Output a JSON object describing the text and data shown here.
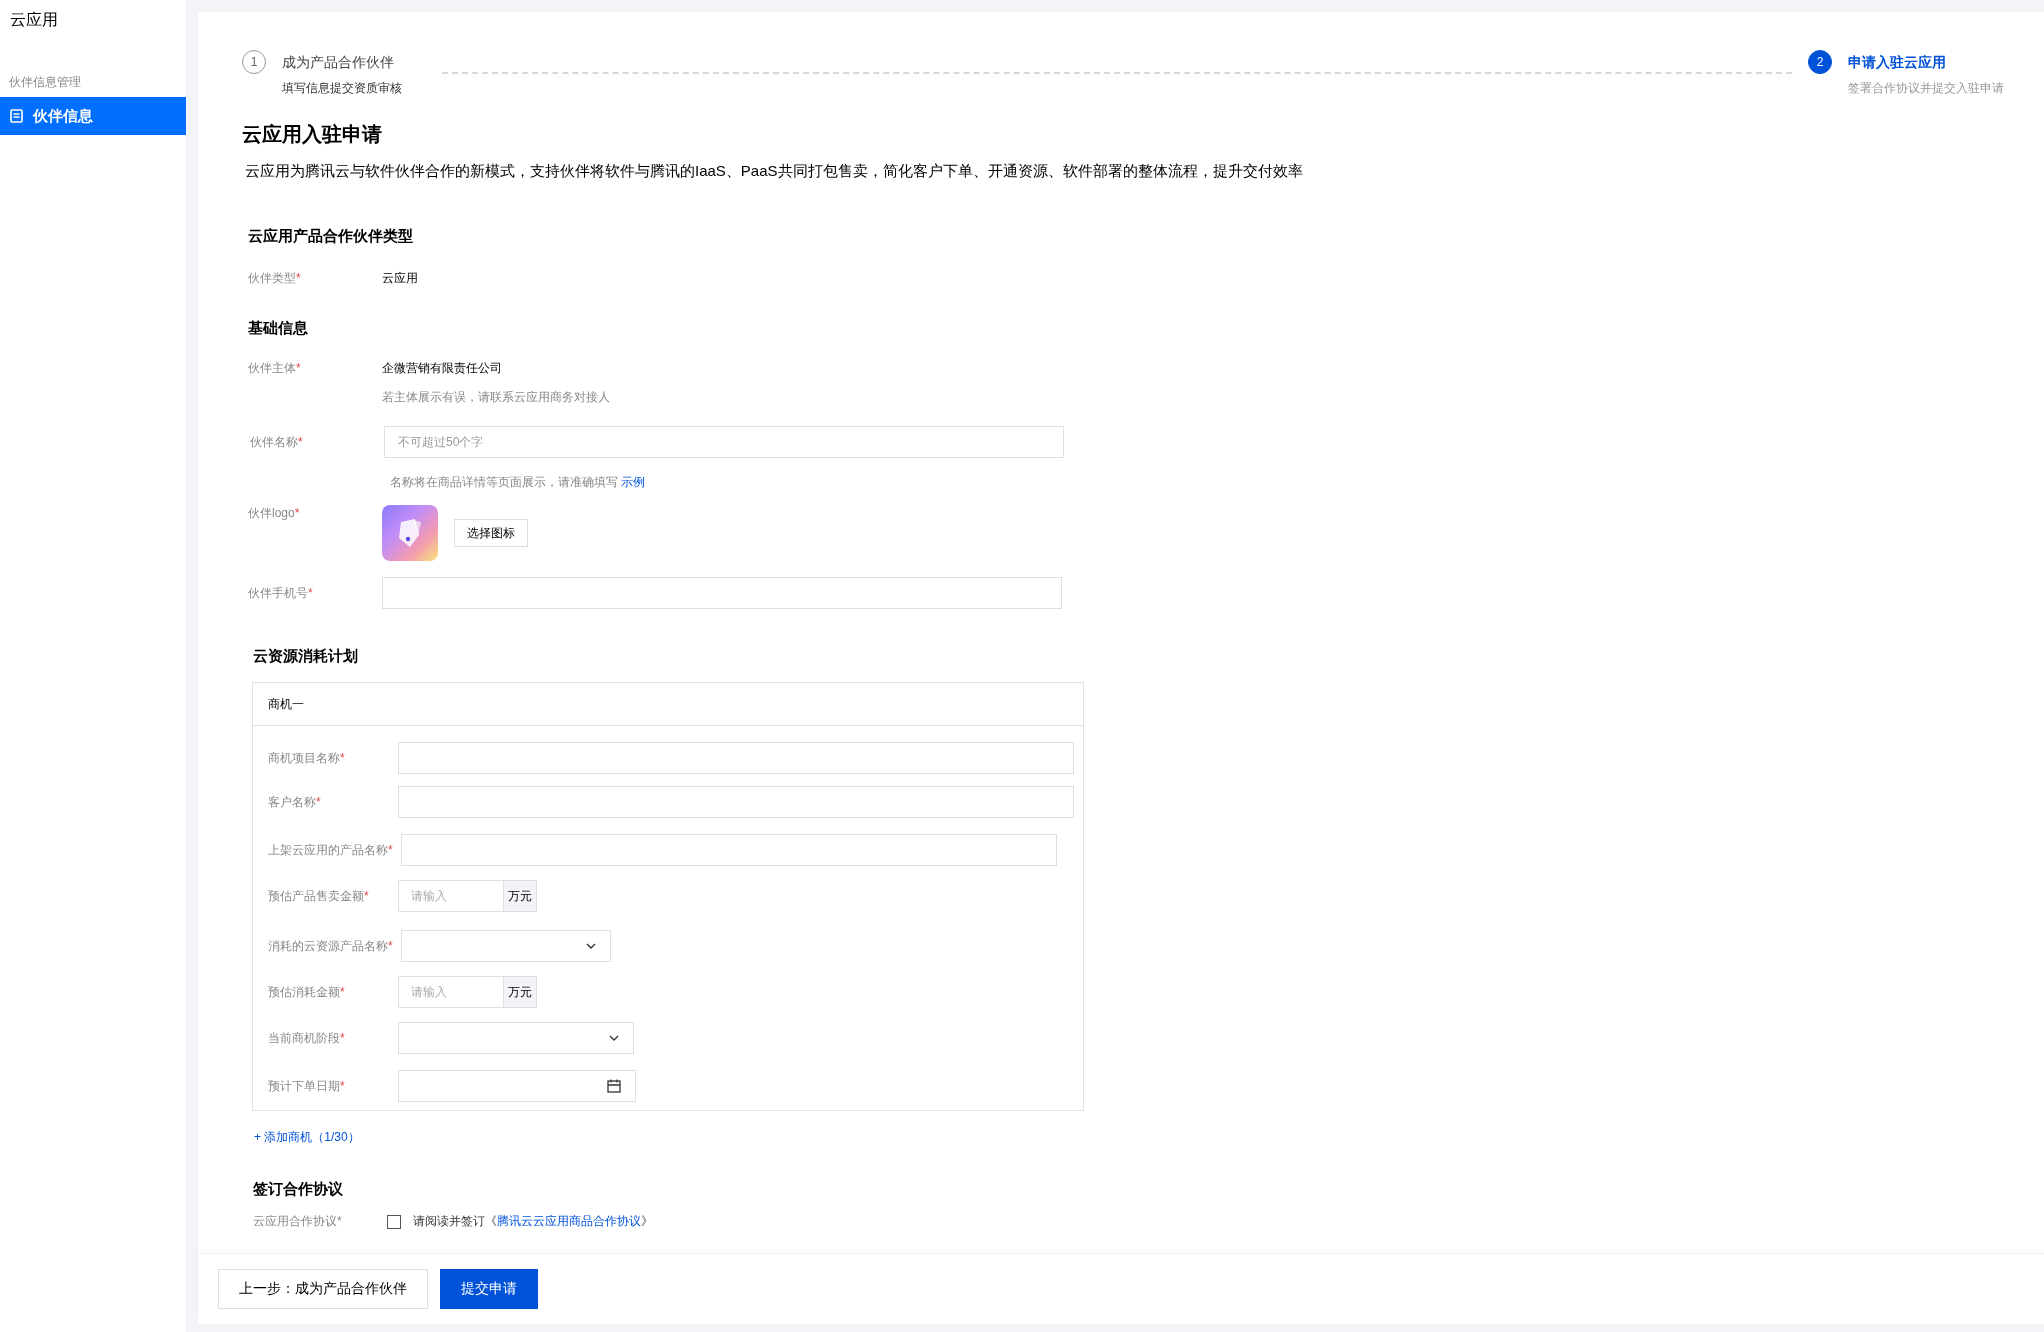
{
  "sidebar": {
    "title": "云应用",
    "group": "伙伴信息管理",
    "items": [
      {
        "label": "伙伴信息",
        "selected": true
      }
    ]
  },
  "steps": [
    {
      "number": "1",
      "title": "成为产品合作伙伴",
      "subtitle": "填写信息提交资质审核",
      "active": false
    },
    {
      "number": "2",
      "title": "申请入驻云应用",
      "subtitle": "签署合作协议并提交入驻申请",
      "active": true
    }
  ],
  "page": {
    "title": "云应用入驻申请",
    "description": "云应用为腾讯云与软件伙伴合作的新模式，支持伙伴将软件与腾讯的IaaS、PaaS共同打包售卖，简化客户下单、开通资源、软件部署的整体流程，提升交付效率"
  },
  "partner_type": {
    "heading": "云应用产品合作伙伴类型",
    "label": "伙伴类型",
    "required_mark": "*",
    "value": "云应用"
  },
  "basic_info": {
    "heading": "基础信息",
    "fields": [
      {
        "kind": "text",
        "label": "伙伴主体",
        "required_mark": "*",
        "value": "企微营销有限责任公司",
        "hint": "若主体展示有误，请联系云应用商务对接人"
      },
      {
        "kind": "input",
        "label": "伙伴名称",
        "required_mark": "*",
        "placeholder": "不可超过50个字",
        "hint": "名称将在商品详情等页面展示，请准确填写",
        "hint_link": "示例"
      },
      {
        "kind": "logo",
        "label": "伙伴logo",
        "required_mark": "*",
        "button": "选择图标"
      },
      {
        "kind": "input",
        "label": "伙伴手机号",
        "required_mark": "*"
      }
    ]
  },
  "consumption_plan": {
    "heading": "云资源消耗计划",
    "opportunities": [
      {
        "title": "商机一",
        "fields": [
          {
            "kind": "input",
            "label": "商机项目名称",
            "required_mark": "*"
          },
          {
            "kind": "input",
            "label": "客户名称",
            "required_mark": "*"
          },
          {
            "kind": "input",
            "label": "上架云应用的产品名称",
            "required_mark": "*"
          },
          {
            "kind": "amount",
            "label": "预估产品售卖金额",
            "required_mark": "*",
            "placeholder": "请输入",
            "unit": "万元"
          },
          {
            "kind": "select",
            "label": "消耗的云资源产品名称",
            "required_mark": "*"
          },
          {
            "kind": "amount",
            "label": "预估消耗金额",
            "required_mark": "*",
            "placeholder": "请输入",
            "unit": "万元"
          },
          {
            "kind": "select",
            "label": "当前商机阶段",
            "required_mark": "*"
          },
          {
            "kind": "date",
            "label": "预计下单日期",
            "required_mark": "*"
          }
        ]
      }
    ],
    "add_link": "+ 添加商机（1/30）"
  },
  "agreement": {
    "heading": "签订合作协议",
    "label": "云应用合作协议",
    "required_mark": "*",
    "checked": false,
    "text": "请阅读并签订《",
    "link": "腾讯云云应用商品合作协议",
    "text_end": "》"
  },
  "footer": {
    "buttons": [
      {
        "label": "上一步：成为产品合作伙伴",
        "kind": "secondary"
      },
      {
        "label": "提交申请",
        "kind": "primary"
      }
    ]
  }
}
